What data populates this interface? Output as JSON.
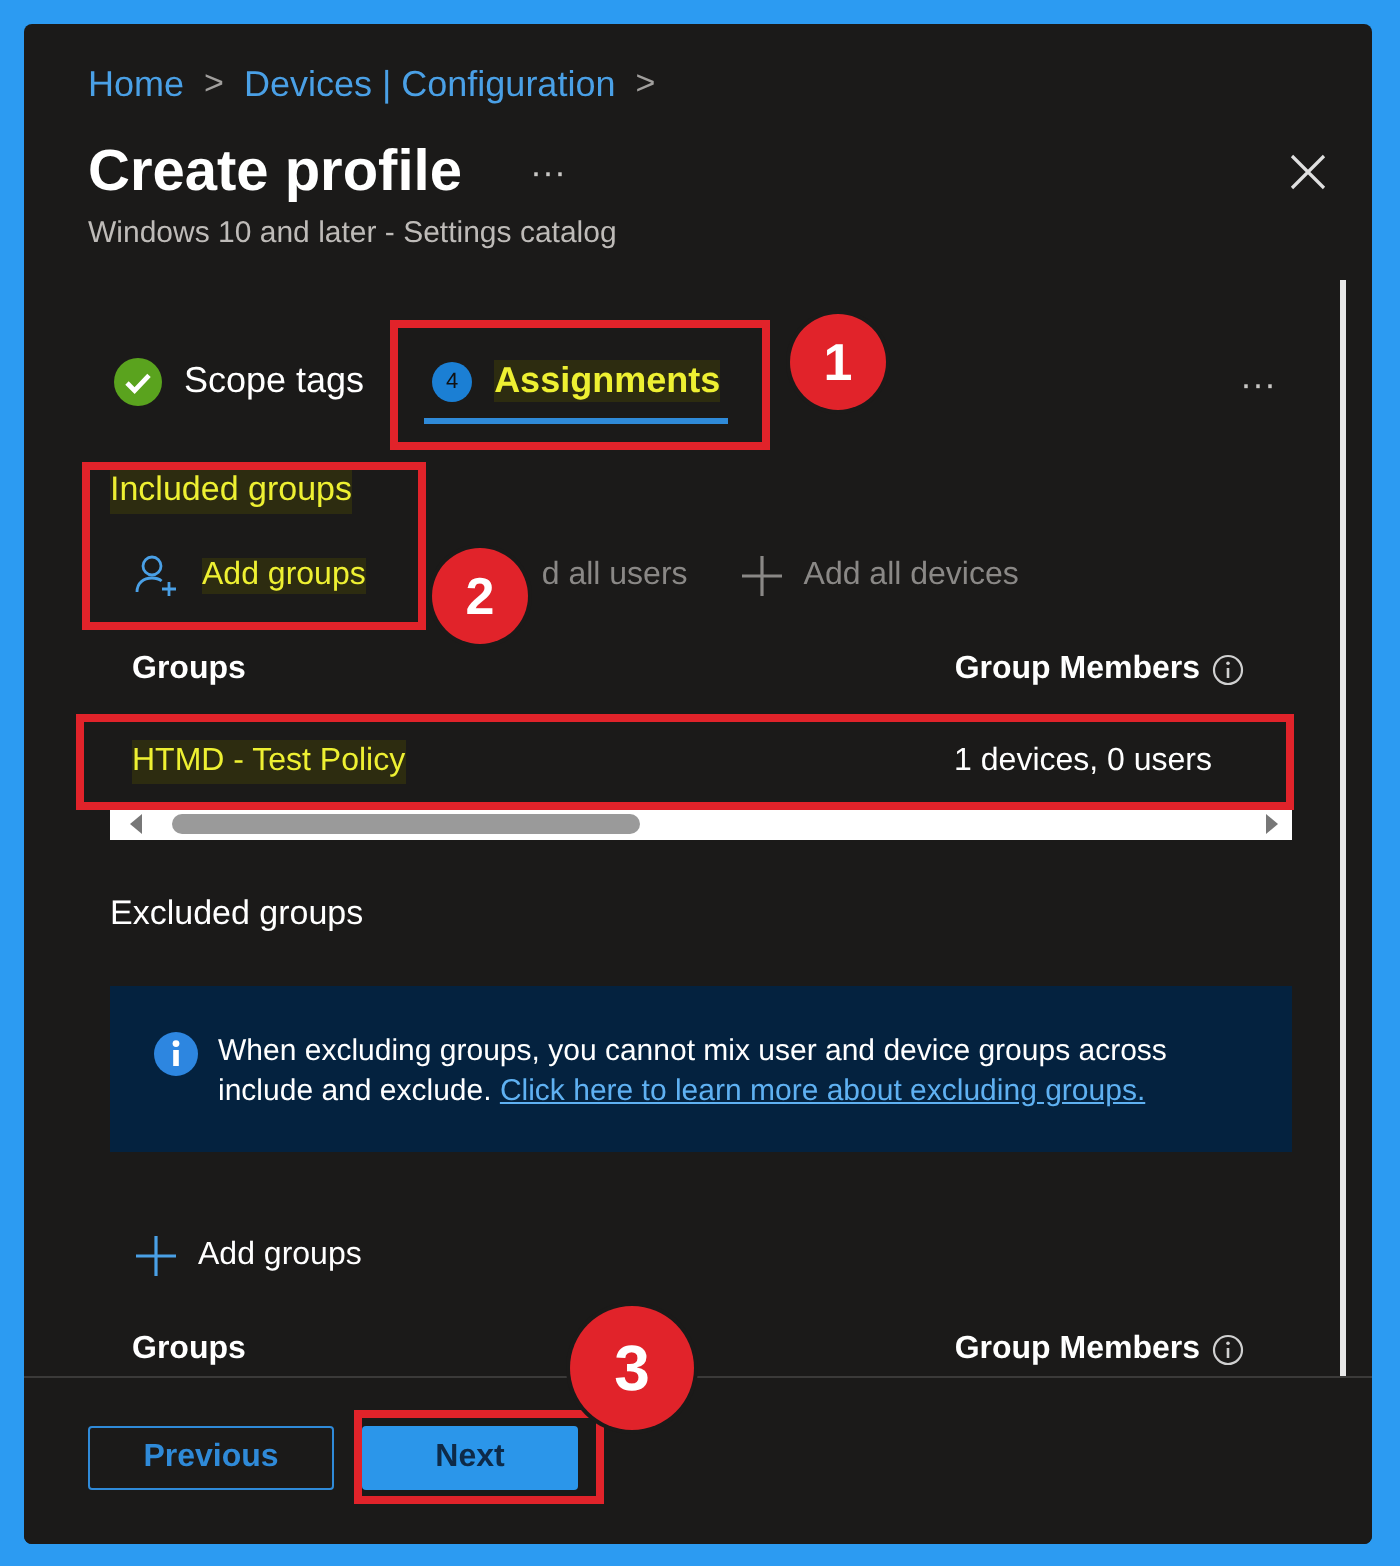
{
  "breadcrumb": [
    {
      "label": "Home"
    },
    {
      "label": "Devices | Configuration"
    }
  ],
  "breadcrumb_separator": ">",
  "title": "Create profile",
  "title_more": "···",
  "subtitle": "Windows 10 and later - Settings catalog",
  "tabs": [
    {
      "label": "Scope tags",
      "kind": "done",
      "selected": false,
      "highlighted": false
    },
    {
      "label": "Assignments",
      "kind": "step",
      "step": "4",
      "selected": true,
      "highlighted": true,
      "outlined": true
    }
  ],
  "tabs_more": "···",
  "included": {
    "title": "Included groups",
    "highlighted": true,
    "outlined": true,
    "actions": [
      {
        "label": "Add groups",
        "kind": "add-person",
        "disabled": false,
        "highlighted": true
      },
      {
        "label": "d all users",
        "kind": "none",
        "disabled": true,
        "highlighted": false
      },
      {
        "label": "Add all devices",
        "kind": "plus",
        "disabled": true,
        "highlighted": false
      }
    ],
    "columns": [
      "Groups",
      "Group Members"
    ],
    "rows": [
      {
        "cells": [
          "HTMD - Test Policy",
          "1 devices, 0 users"
        ],
        "highlighted": true,
        "outlined": true
      }
    ]
  },
  "excluded": {
    "title": "Excluded groups",
    "info": "When excluding groups, you cannot mix user and device groups across include and exclude.",
    "info_link": "Click here to learn more about excluding groups.",
    "actions": [
      {
        "label": "Add groups",
        "kind": "plus",
        "disabled": false,
        "highlighted": false
      }
    ],
    "columns": [
      "Groups",
      "Group Members"
    ]
  },
  "footer": [
    {
      "label": "Previous",
      "kind": "secondary"
    },
    {
      "label": "Next",
      "kind": "primary",
      "outlined": true
    }
  ],
  "annotations": [
    {
      "label": "1"
    },
    {
      "label": "2"
    },
    {
      "label": "3"
    }
  ]
}
